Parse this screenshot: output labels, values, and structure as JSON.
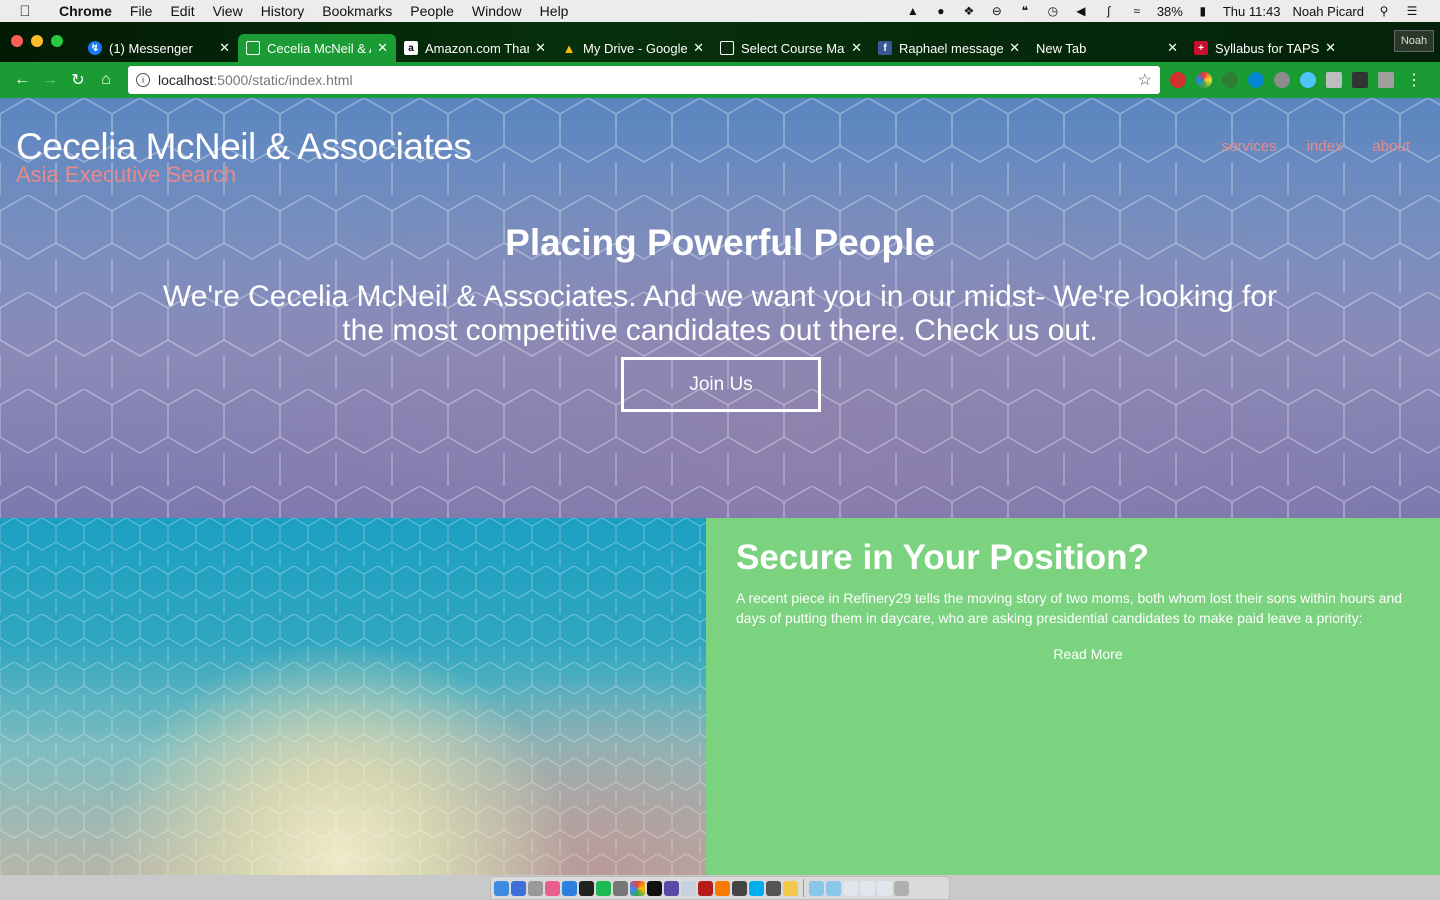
{
  "menubar": {
    "app": "Chrome",
    "items": [
      "File",
      "Edit",
      "View",
      "History",
      "Bookmarks",
      "People",
      "Window",
      "Help"
    ],
    "battery": "38%",
    "clock": "Thu 11:43",
    "user": "Noah Picard"
  },
  "tabs": [
    {
      "label": "(1) Messenger",
      "icon": "messenger-icon",
      "color": "#1877f2"
    },
    {
      "label": "Cecelia McNeil & A",
      "icon": "document-icon",
      "color": "#ffffff",
      "active": true
    },
    {
      "label": "Amazon.com Than",
      "icon": "amazon-icon",
      "color": "#ffffff"
    },
    {
      "label": "My Drive - Google",
      "icon": "google-drive-icon",
      "color": "#fbbc04"
    },
    {
      "label": "Select Course Mat",
      "icon": "document-icon",
      "color": "#ffffff"
    },
    {
      "label": "Raphael message",
      "icon": "facebook-icon",
      "color": "#3b5998"
    },
    {
      "label": "New Tab",
      "icon": "",
      "color": ""
    },
    {
      "label": "Syllabus for TAPS",
      "icon": "shield-icon",
      "color": "#c8102e"
    }
  ],
  "profile_label": "Noah",
  "omnibox": {
    "host": "localhost",
    "path": ":5000/static/index.html"
  },
  "site": {
    "brand_title": "Cecelia McNeil & Associates",
    "brand_subtitle": "Asia Executive Search",
    "nav": [
      "services",
      "index",
      "about"
    ],
    "hero_heading": "Placing Powerful People",
    "hero_text": "We're Cecelia McNeil & Associates. And we want you in our midst- We're looking for the most competitive candidates out there. Check us out.",
    "join_label": "Join Us",
    "card_heading": "Secure in Your Position?",
    "card_text": "A recent piece in Refinery29 tells the moving story of two moms, both whom lost their sons within hours and days of putting them in daycare, who are asking presidential candidates to make paid leave a priority:",
    "read_more": "Read More"
  },
  "colors": {
    "tab_active": "#1a9b33",
    "accent_pink": "#e88a8a",
    "card_green": "#7bd37f"
  }
}
